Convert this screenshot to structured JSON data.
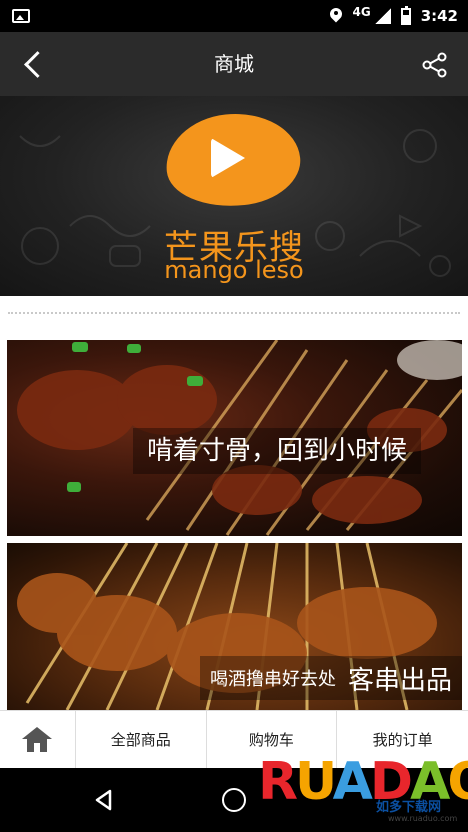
{
  "status_bar": {
    "network": "4G",
    "time": "3:42"
  },
  "nav": {
    "title": "商城"
  },
  "banner": {
    "brand_cn": "芒果乐搜",
    "brand_en": "mango leso"
  },
  "cards": [
    {
      "caption": "啃着寸骨，回到小时候"
    },
    {
      "caption_small": "喝酒撸串好去处",
      "caption_big": "客串出品"
    }
  ],
  "tabs": [
    {
      "label": "全部商品"
    },
    {
      "label": "购物车"
    },
    {
      "label": "我的订单"
    }
  ],
  "watermark": {
    "text": "RUANDAO",
    "sub": "如多下载网",
    "url": "www.ruaduo.com"
  },
  "colors": {
    "accent": "#f4951c",
    "nav_bg": "#2b2b2b"
  },
  "icons": [
    "image-icon",
    "location-icon",
    "signal-icon",
    "battery-icon",
    "back-icon",
    "share-icon",
    "play-icon",
    "home-icon",
    "system-back-icon",
    "system-home-icon"
  ]
}
